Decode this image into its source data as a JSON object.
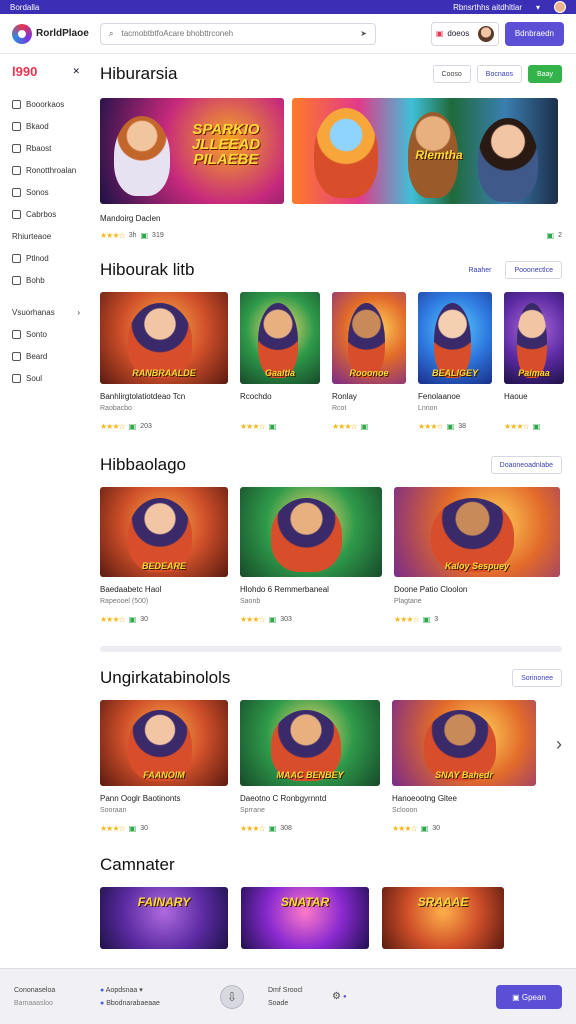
{
  "system_bar": {
    "left_label": "Bordalla",
    "right_text": "Rbnsrthhs aitdhltlar"
  },
  "header": {
    "logo_text": "RorldPlaoe",
    "search_placeholder": "tacmobtbtfoAcare bhobttrconeh",
    "account_label": "doeos",
    "primary_button": "Bdnbraedn"
  },
  "sidebar": {
    "brand": "l990",
    "items": [
      "Booorkaos",
      "Bkaod",
      "Rbaost",
      "Ronotthroalan",
      "Sonos",
      "Cabrbos"
    ],
    "section_label": "Rhiurteaoe",
    "items2": [
      "Ptlnod",
      "Bohb"
    ],
    "section2_label": "Vsuorhanas",
    "items3": [
      "Sonto",
      "Beard",
      "Soul"
    ]
  },
  "featured": {
    "title": "Hiburarsia",
    "buttons": [
      "Cooso",
      "Bocnaos",
      "Baay"
    ],
    "banner_text": "SPARKIO JLLEEAD PILAEBE",
    "banner2_text": "Rlemtha",
    "card_title": "Mandoirg Daclen",
    "card_rating": "3h",
    "card_count": "319",
    "card_count_right": "2"
  },
  "section2": {
    "title": "Hibourak litb",
    "link": "Raaher",
    "button": "Pooonectlce",
    "cards": [
      {
        "tile": "RANBRAALDE",
        "title": "Banhlirgtolatiotdeao Tcn",
        "sub": "Raobacbo",
        "count": "203"
      },
      {
        "tile": "Gaaltla",
        "title": "Rcochdo",
        "sub": "",
        "count": ""
      },
      {
        "tile": "Rooonoe",
        "title": "Ronlay",
        "sub": "Rcot",
        "count": ""
      },
      {
        "tile": "BEALIGEY",
        "title": "Fenolaanoe",
        "sub": "Lnnon",
        "count": "38"
      },
      {
        "tile": "Paimaa",
        "title": "Haoue",
        "sub": "",
        "count": ""
      }
    ]
  },
  "section3": {
    "title": "Hibbaolago",
    "button": "Doaoneoadnlabe",
    "cards": [
      {
        "tile": "BEDEARE",
        "title": "Baedaabetc Haol",
        "sub": "Rapeooel (500)",
        "count": "30"
      },
      {
        "tile": "",
        "title": "Hlohdo 6 Remmerbaneal",
        "sub": "Saonb",
        "count": "303"
      },
      {
        "tile": "Kaloy Sespuey",
        "title": "Doone Patio Cloolon",
        "sub": "Plagtane",
        "count": "3"
      }
    ]
  },
  "section4": {
    "title": "Ungirkatabinolols",
    "button": "Sorinonee",
    "cards": [
      {
        "tile": "FAANOIM",
        "title": "Pann Ooglr Baotinonts",
        "sub": "Sooraan",
        "count": "30"
      },
      {
        "tile": "MAAC BENBEY",
        "title": "Daeotno C Ronbgyrnntd",
        "sub": "Sprrane",
        "count": "308"
      },
      {
        "tile": "SNAY Bahedr",
        "title": "Hanoeootng Gltee",
        "sub": "Sclooon",
        "count": "30"
      }
    ]
  },
  "section5": {
    "title": "Camnater",
    "tiles": [
      "FAINARY",
      "SNATAR",
      "SRAAAE"
    ]
  },
  "bottom_bar": {
    "left_title": "Cononaseloa",
    "left_sub": "Bamaaasloo",
    "col2_a": "Aopdsnaa",
    "col2_b": "Bbodnarabaeaae",
    "col3_a": "Dmf Sroocl",
    "col3_b": "Soade",
    "cta": "Gpean"
  }
}
